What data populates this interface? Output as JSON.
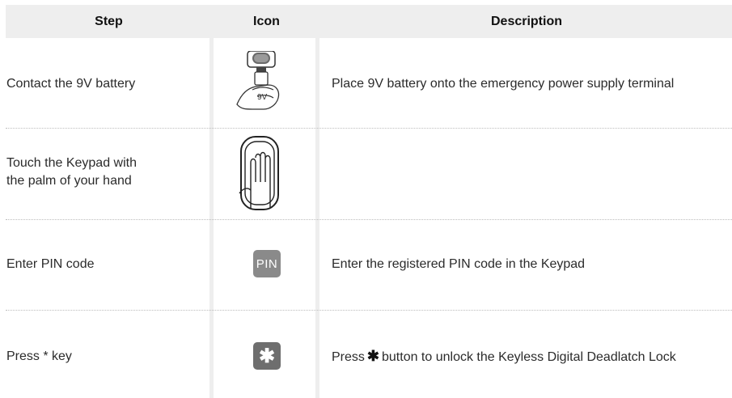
{
  "headers": {
    "step": "Step",
    "icon": "Icon",
    "description": "Description"
  },
  "rows": [
    {
      "step_line1": "Contact the 9V battery",
      "icon": "battery-contact-icon",
      "icon_text": "9V",
      "description": "Place 9V battery onto the emergency power supply terminal"
    },
    {
      "step_line1": "Touch the Keypad with",
      "step_line2": "the palm of your hand",
      "icon": "palm-touch-icon",
      "description": ""
    },
    {
      "step_line1": "Enter PIN code",
      "icon": "pin-key-icon",
      "icon_text": "PIN",
      "description": "Enter the registered PIN code in the Keypad"
    },
    {
      "step_line1": "Press * key",
      "icon": "asterisk-key-icon",
      "icon_text": "✱",
      "description_before": "Press",
      "description_star": "✱",
      "description_after": "button to unlock the Keyless Digital Deadlatch Lock"
    }
  ]
}
